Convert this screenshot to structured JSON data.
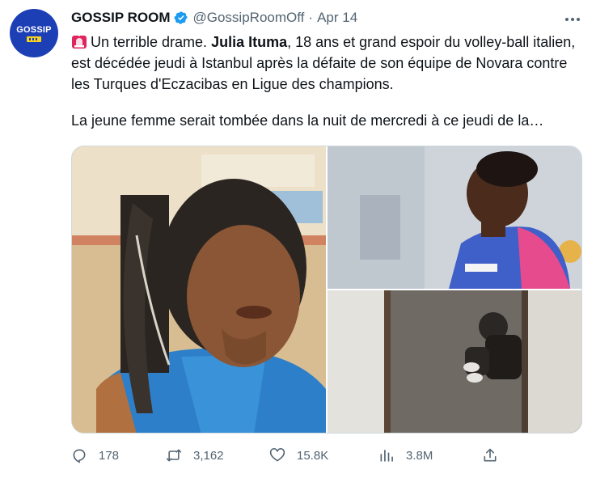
{
  "author": {
    "avatar_text": "GOSSIP",
    "name": "GOSSIP ROOM",
    "handle": "@GossipRoomOff",
    "separator": "·",
    "date": "Apr 14"
  },
  "tweet": {
    "siren_icon": "police-light-icon",
    "line1_plain": "Un terrible drame. ",
    "line1_bold": "Julia Ituma",
    "line1_rest": ", 18 ans et grand espoir du volley-ball italien, est décédée jeudi à Istanbul après la défaite de son équipe de Novara contre les Turques d'Eczacibas en Ligue des champions.",
    "line2": "La jeune femme serait tombée dans la nuit de mercredi à ce jeudi de la…"
  },
  "media": {
    "photo_count": 3
  },
  "actions": {
    "reply_count": "178",
    "retweet_count": "3,162",
    "like_count": "15.8K",
    "views_count": "3.8M"
  }
}
